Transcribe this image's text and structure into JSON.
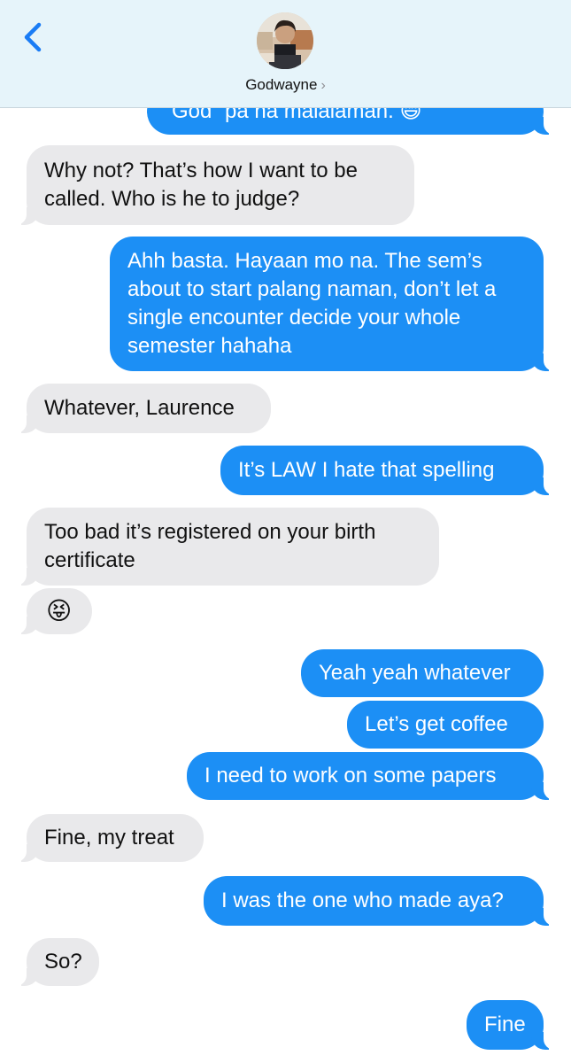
{
  "contact": {
    "name": "Godwayne",
    "chevron": "›"
  },
  "messages": [
    {
      "dir": "out",
      "text": "God” pa na malalaman. 😄"
    },
    {
      "dir": "in",
      "text": "Why not? That’s how I want to be called. Who is he to judge?"
    },
    {
      "dir": "out",
      "text": "Ahh basta. Hayaan mo na. The sem’s about to start palang naman, don’t let a single encounter decide your whole semester hahaha"
    },
    {
      "dir": "in",
      "text": "Whatever, Laurence"
    },
    {
      "dir": "out",
      "text": "It’s LAW I hate that spelling"
    },
    {
      "dir": "in",
      "text": "Too bad it’s registered on your birth certificate"
    },
    {
      "dir": "in",
      "text": "😝"
    },
    {
      "dir": "out",
      "text": "Yeah yeah whatever"
    },
    {
      "dir": "out",
      "text": "Let’s get coffee"
    },
    {
      "dir": "out",
      "text": "I need to work on some papers"
    },
    {
      "dir": "in",
      "text": "Fine, my treat"
    },
    {
      "dir": "out",
      "text": "I was the one who made aya?"
    },
    {
      "dir": "in",
      "text": "So?"
    },
    {
      "dir": "out",
      "text": "Fine"
    }
  ],
  "colors": {
    "outgoing": "#1c8ff5",
    "incoming": "#e9e9eb",
    "header": "#e6f4fa",
    "accent": "#1a7cf5"
  },
  "icons": {
    "back": "chevron-left-icon",
    "avatar": "contact-photo"
  }
}
